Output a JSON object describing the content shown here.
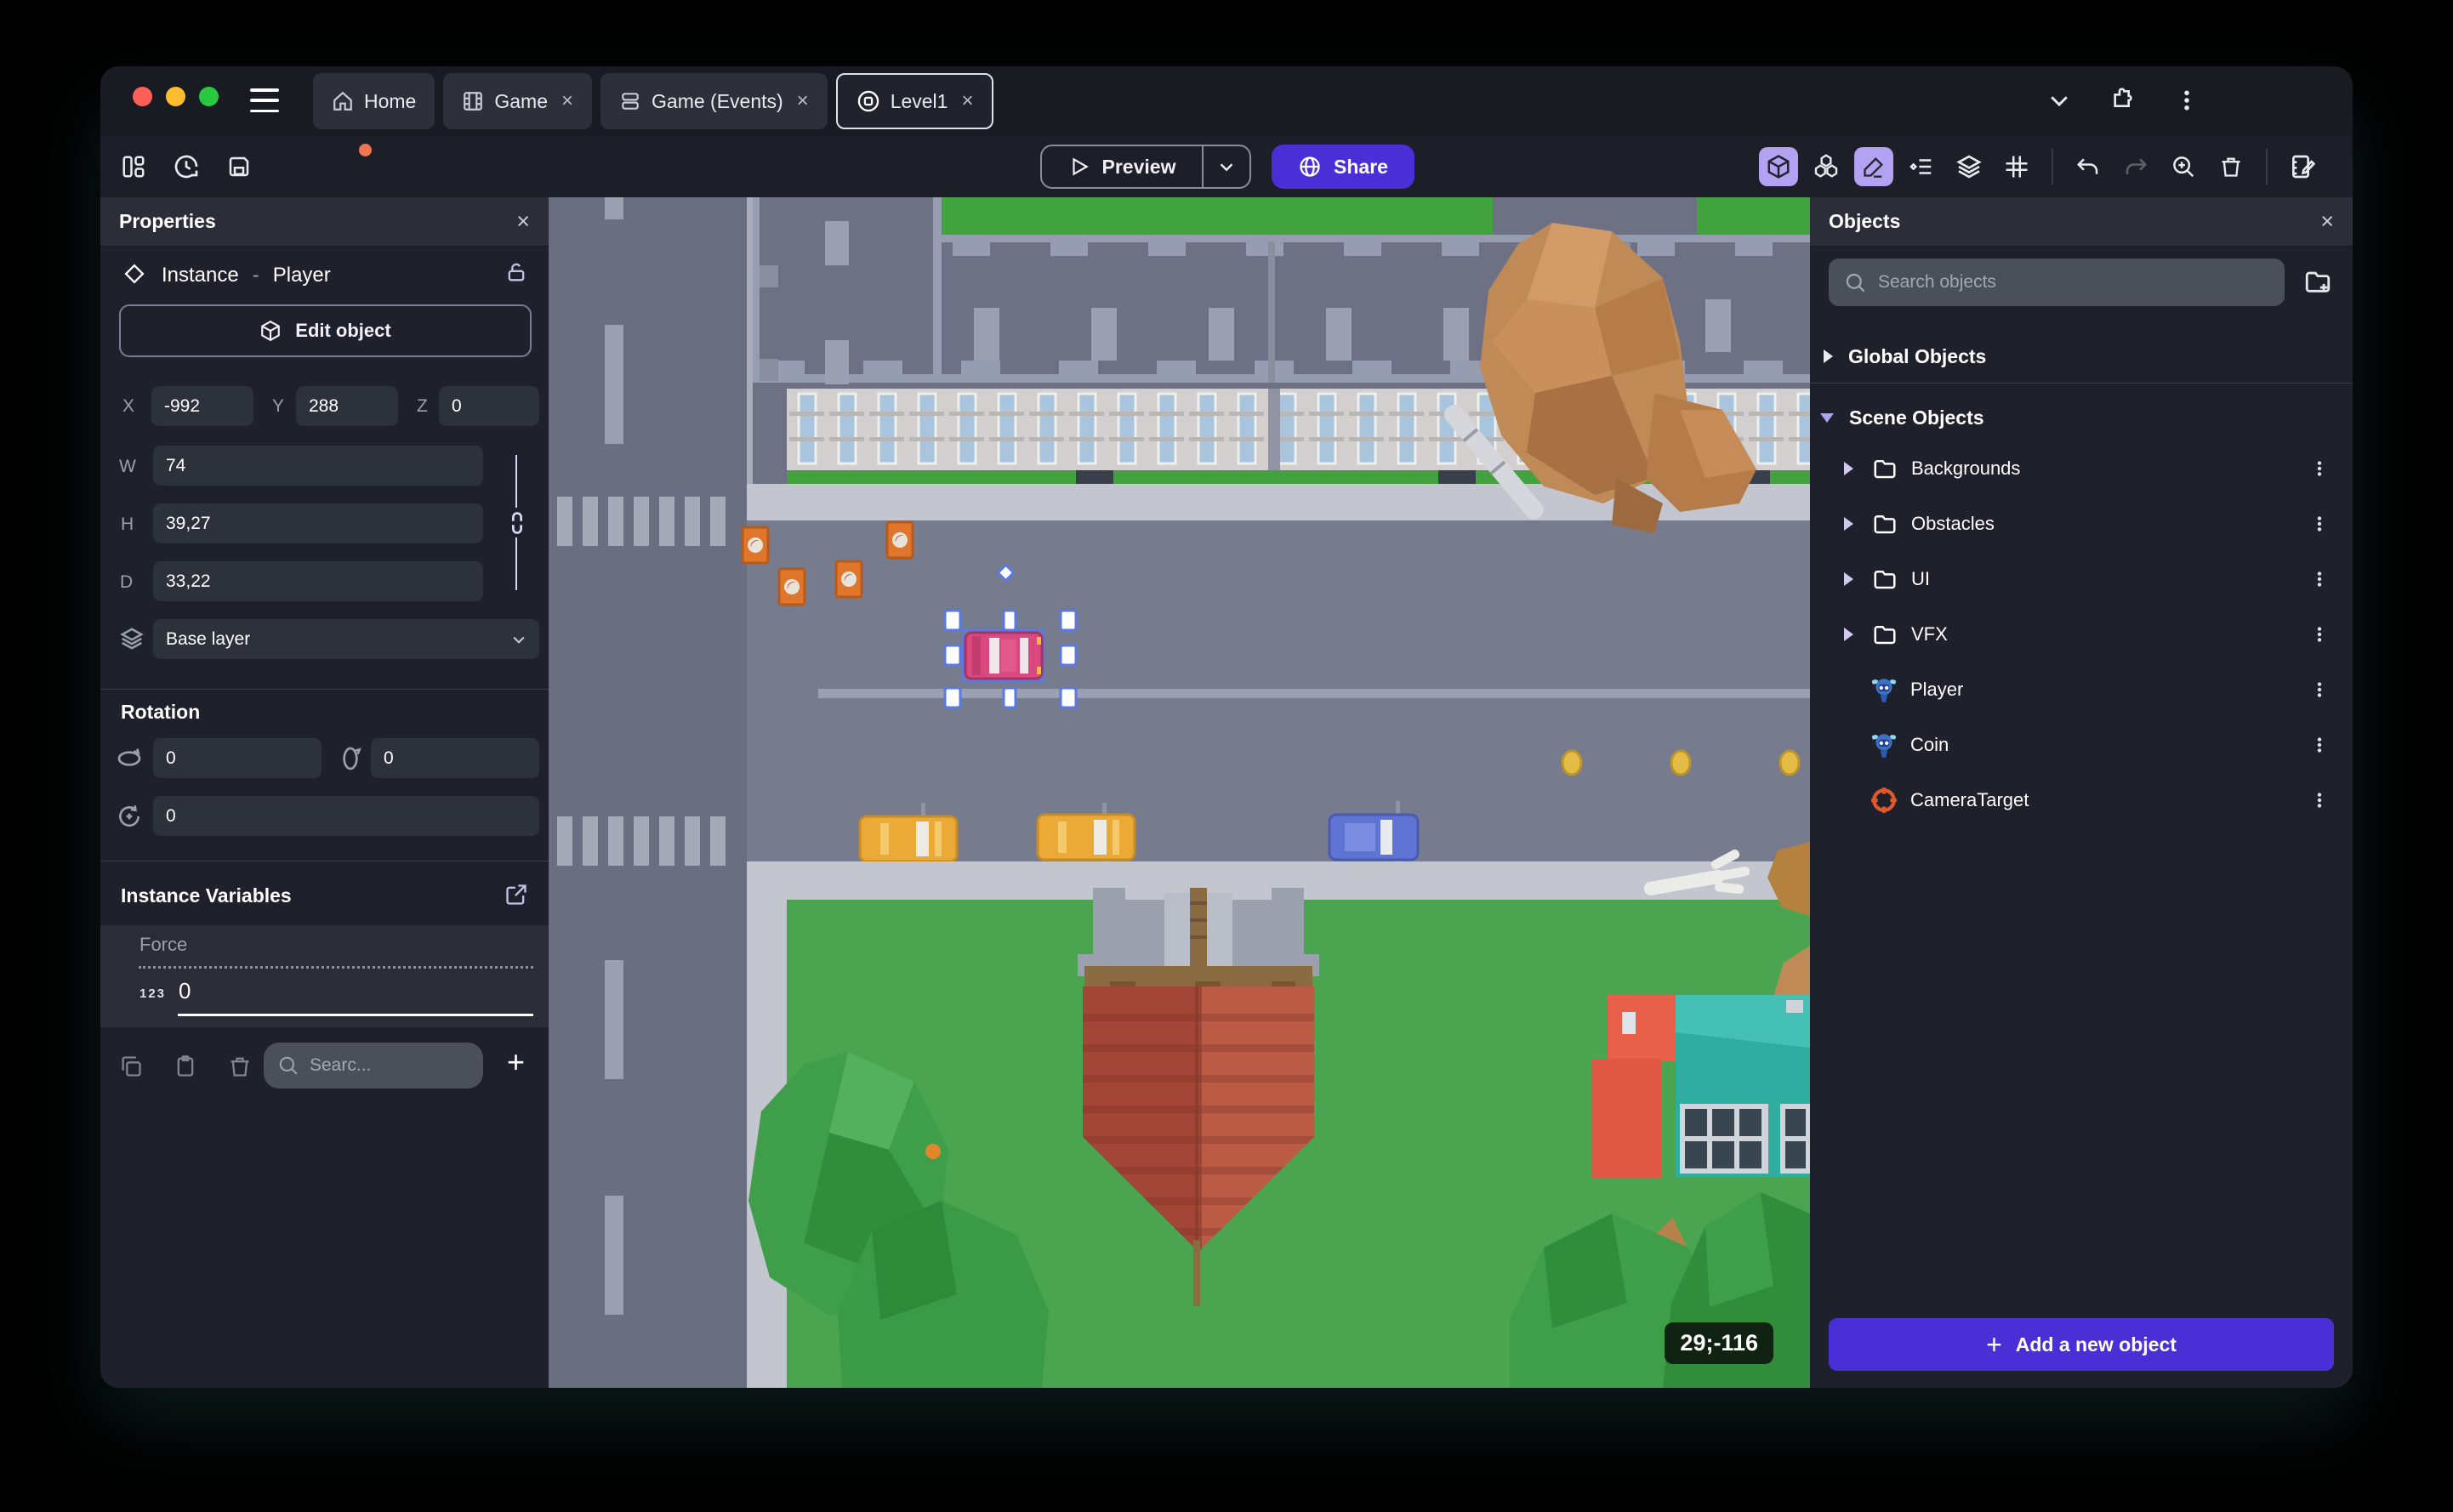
{
  "tabs": [
    {
      "label": "Home",
      "icon": "home-icon",
      "active": false
    },
    {
      "label": "Game",
      "icon": "film-icon",
      "active": false
    },
    {
      "label": "Game (Events)",
      "icon": "events-icon",
      "active": false
    },
    {
      "label": "Level1",
      "icon": "scene-icon",
      "active": true
    }
  ],
  "close_symbol": "×",
  "toolbar": {
    "preview_label": "Preview",
    "share_label": "Share"
  },
  "properties": {
    "title": "Properties",
    "instance_type": "Instance",
    "separator": "-",
    "object_name": "Player",
    "edit_object_label": "Edit object",
    "x_label": "X",
    "x_value": "-992",
    "y_label": "Y",
    "y_value": "288",
    "z_label": "Z",
    "z_value": "0",
    "w_label": "W",
    "w_value": "74",
    "h_label": "H",
    "h_value": "39,27",
    "d_label": "D",
    "d_value": "33,22",
    "layer_value": "Base layer",
    "rotation_title": "Rotation",
    "rotation_x": "0",
    "rotation_y": "0",
    "rotation_z": "0",
    "instance_variables_title": "Instance Variables",
    "variable_name": "Force",
    "variable_type": "123",
    "variable_value": "0",
    "search_placeholder": "Searc..."
  },
  "objects": {
    "title": "Objects",
    "search_placeholder": "Search objects",
    "global_group": "Global Objects",
    "scene_group": "Scene Objects",
    "folders": [
      {
        "label": "Backgrounds"
      },
      {
        "label": "Obstacles"
      },
      {
        "label": "UI"
      },
      {
        "label": "VFX"
      }
    ],
    "items": [
      {
        "label": "Player",
        "icon": "monkey-icon"
      },
      {
        "label": "Coin",
        "icon": "monkey-icon"
      },
      {
        "label": "CameraTarget",
        "icon": "target-icon"
      }
    ],
    "add_button_label": "Add a new object"
  },
  "scene": {
    "coordinates_badge": "29;-116"
  },
  "colors": {
    "accent": "#4b2fd6",
    "active_toggle": "#b3a2f1",
    "unsaved_dot": "#f0764f",
    "selection": "#5a79e8",
    "traffic_red": "#ff5f57",
    "traffic_yellow": "#febc2e",
    "traffic_green": "#28c840"
  }
}
